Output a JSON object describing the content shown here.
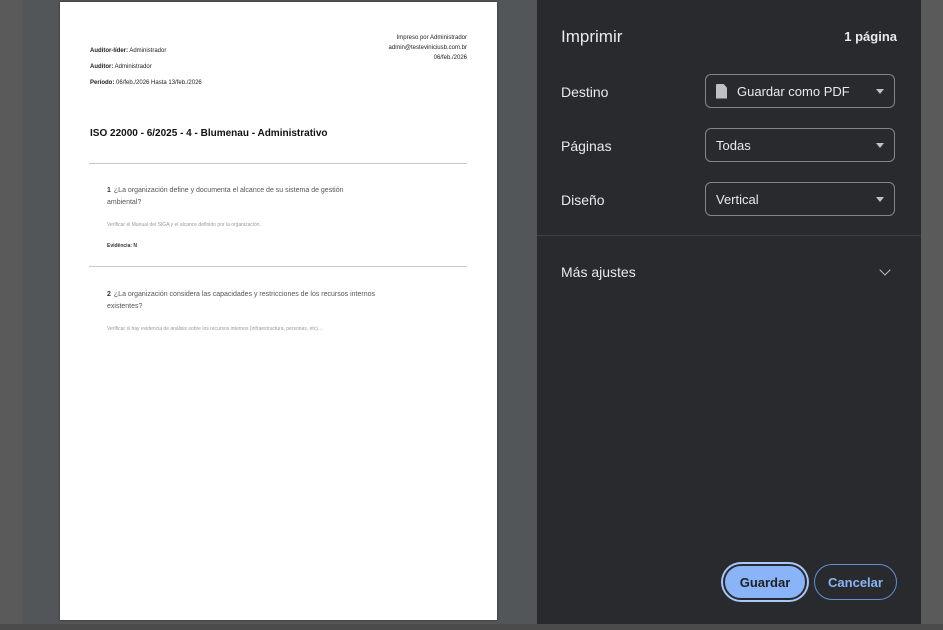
{
  "page_preview": {
    "printed_by": [
      "Impreso por Administrador",
      "admin@testeviniciusb.com.br",
      "06/feb./2026"
    ],
    "lead_auditor_label": "Auditor-líder:",
    "lead_auditor_value": "Administrador",
    "auditor_label": "Auditor:",
    "auditor_value": "Administrador",
    "period_label": "Período:",
    "period_value": "06/feb./2026 Hasta 13/feb./2026",
    "title": "ISO 22000 - 6/2025 - 4 - Blumenau - Administrativo",
    "questions": [
      {
        "number": "1",
        "text": "¿La organización define y documenta el alcance de su sistema de gestión ambiental?",
        "hint": "Verificar el Manual del SIGA y el alcance definido por la organización.",
        "evidence": "Evidência: N"
      },
      {
        "number": "2",
        "text": "¿La organización considera las capacidades y restricciones de los recursos internos existentes?",
        "hint": "Verificar si hay evidencia de análisis sobre los recursos internos (infraestructura, personas, etc)..."
      }
    ]
  },
  "panel": {
    "title": "Imprimir",
    "page_count": "1 página",
    "destination_label": "Destino",
    "destination_value": "Guardar como PDF",
    "pages_label": "Páginas",
    "pages_value": "Todas",
    "layout_label": "Diseño",
    "layout_value": "Vertical",
    "more_settings": "Más ajustes",
    "save_button": "Guardar",
    "cancel_button": "Cancelar"
  },
  "colors": {
    "panel_bg": "#292a2d",
    "accent": "#8ab4f8",
    "preview_bg": "#525659"
  },
  "icons": [
    "file-icon",
    "dropdown-caret-icon",
    "chevron-down-icon"
  ]
}
